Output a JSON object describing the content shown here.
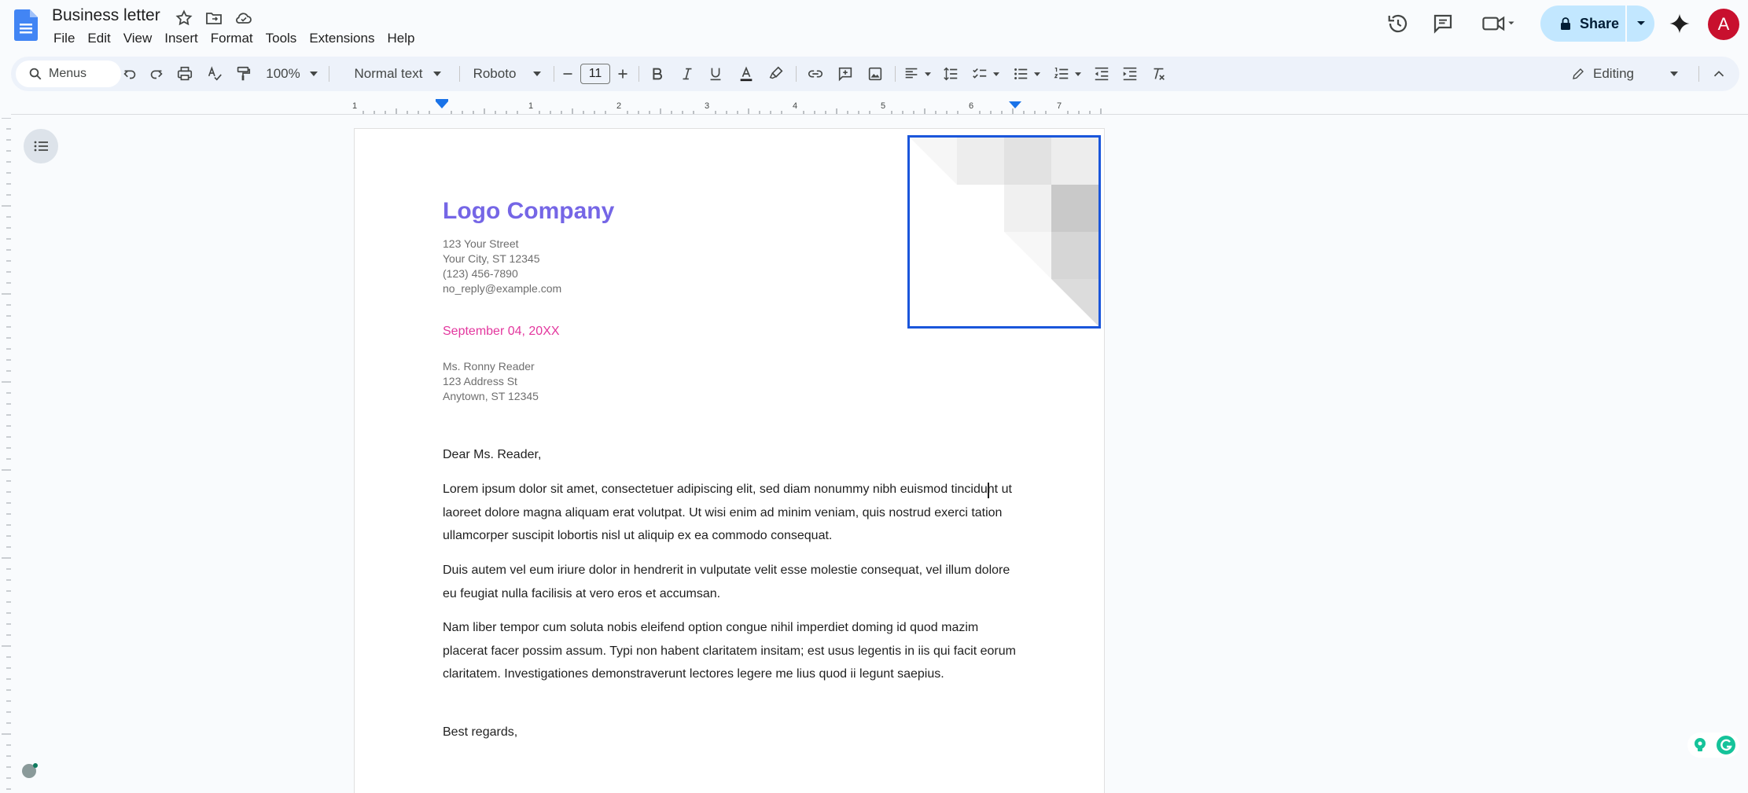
{
  "window": {
    "title": "Business letter"
  },
  "menu": [
    "File",
    "Edit",
    "View",
    "Insert",
    "Format",
    "Tools",
    "Extensions",
    "Help"
  ],
  "header_right": {
    "share_label": "Share",
    "avatar_letter": "A"
  },
  "toolbar": {
    "search_placeholder": "Menus",
    "zoom": "100%",
    "style": "Normal text",
    "font": "Roboto",
    "font_size": "11",
    "mode": "Editing"
  },
  "ruler_numbers": [
    "1",
    "1",
    "2",
    "3",
    "4",
    "5",
    "6",
    "7"
  ],
  "letter": {
    "company": "Logo Company",
    "sender_address": [
      "123 Your Street",
      "Your City, ST 12345",
      "(123) 456-7890",
      "no_reply@example.com"
    ],
    "date": "September 04, 20XX",
    "recipient_address": [
      "Ms. Ronny Reader",
      "123 Address St",
      "Anytown, ST 12345"
    ],
    "salutation": "Dear Ms. Reader,",
    "paragraphs": [
      "Lorem ipsum dolor sit amet, consectetuer adipiscing elit, sed diam nonummy nibh euismod tincidunt ut laoreet dolore magna aliquam erat volutpat. Ut wisi enim ad minim veniam, quis nostrud exerci tation ullamcorper suscipit lobortis nisl ut aliquip ex ea commodo consequat.",
      "Duis autem vel eum iriure dolor in hendrerit in vulputate velit esse molestie consequat, vel illum dolore eu feugiat nulla facilisis at vero eros et accumsan.",
      "Nam liber tempor cum soluta nobis eleifend option congue nihil imperdiet doming id quod mazim placerat facer possim assum. Typi non habent claritatem insitam; est usus legentis in iis qui facit eorum claritatem. Investigationes demonstraverunt lectores legere me lius quod ii legunt saepius."
    ],
    "closing": "Best regards,"
  },
  "colors": {
    "accent": "#7566e6",
    "date": "#e3379e",
    "selection": "#1a56db",
    "share_bg": "#c2e7ff"
  }
}
